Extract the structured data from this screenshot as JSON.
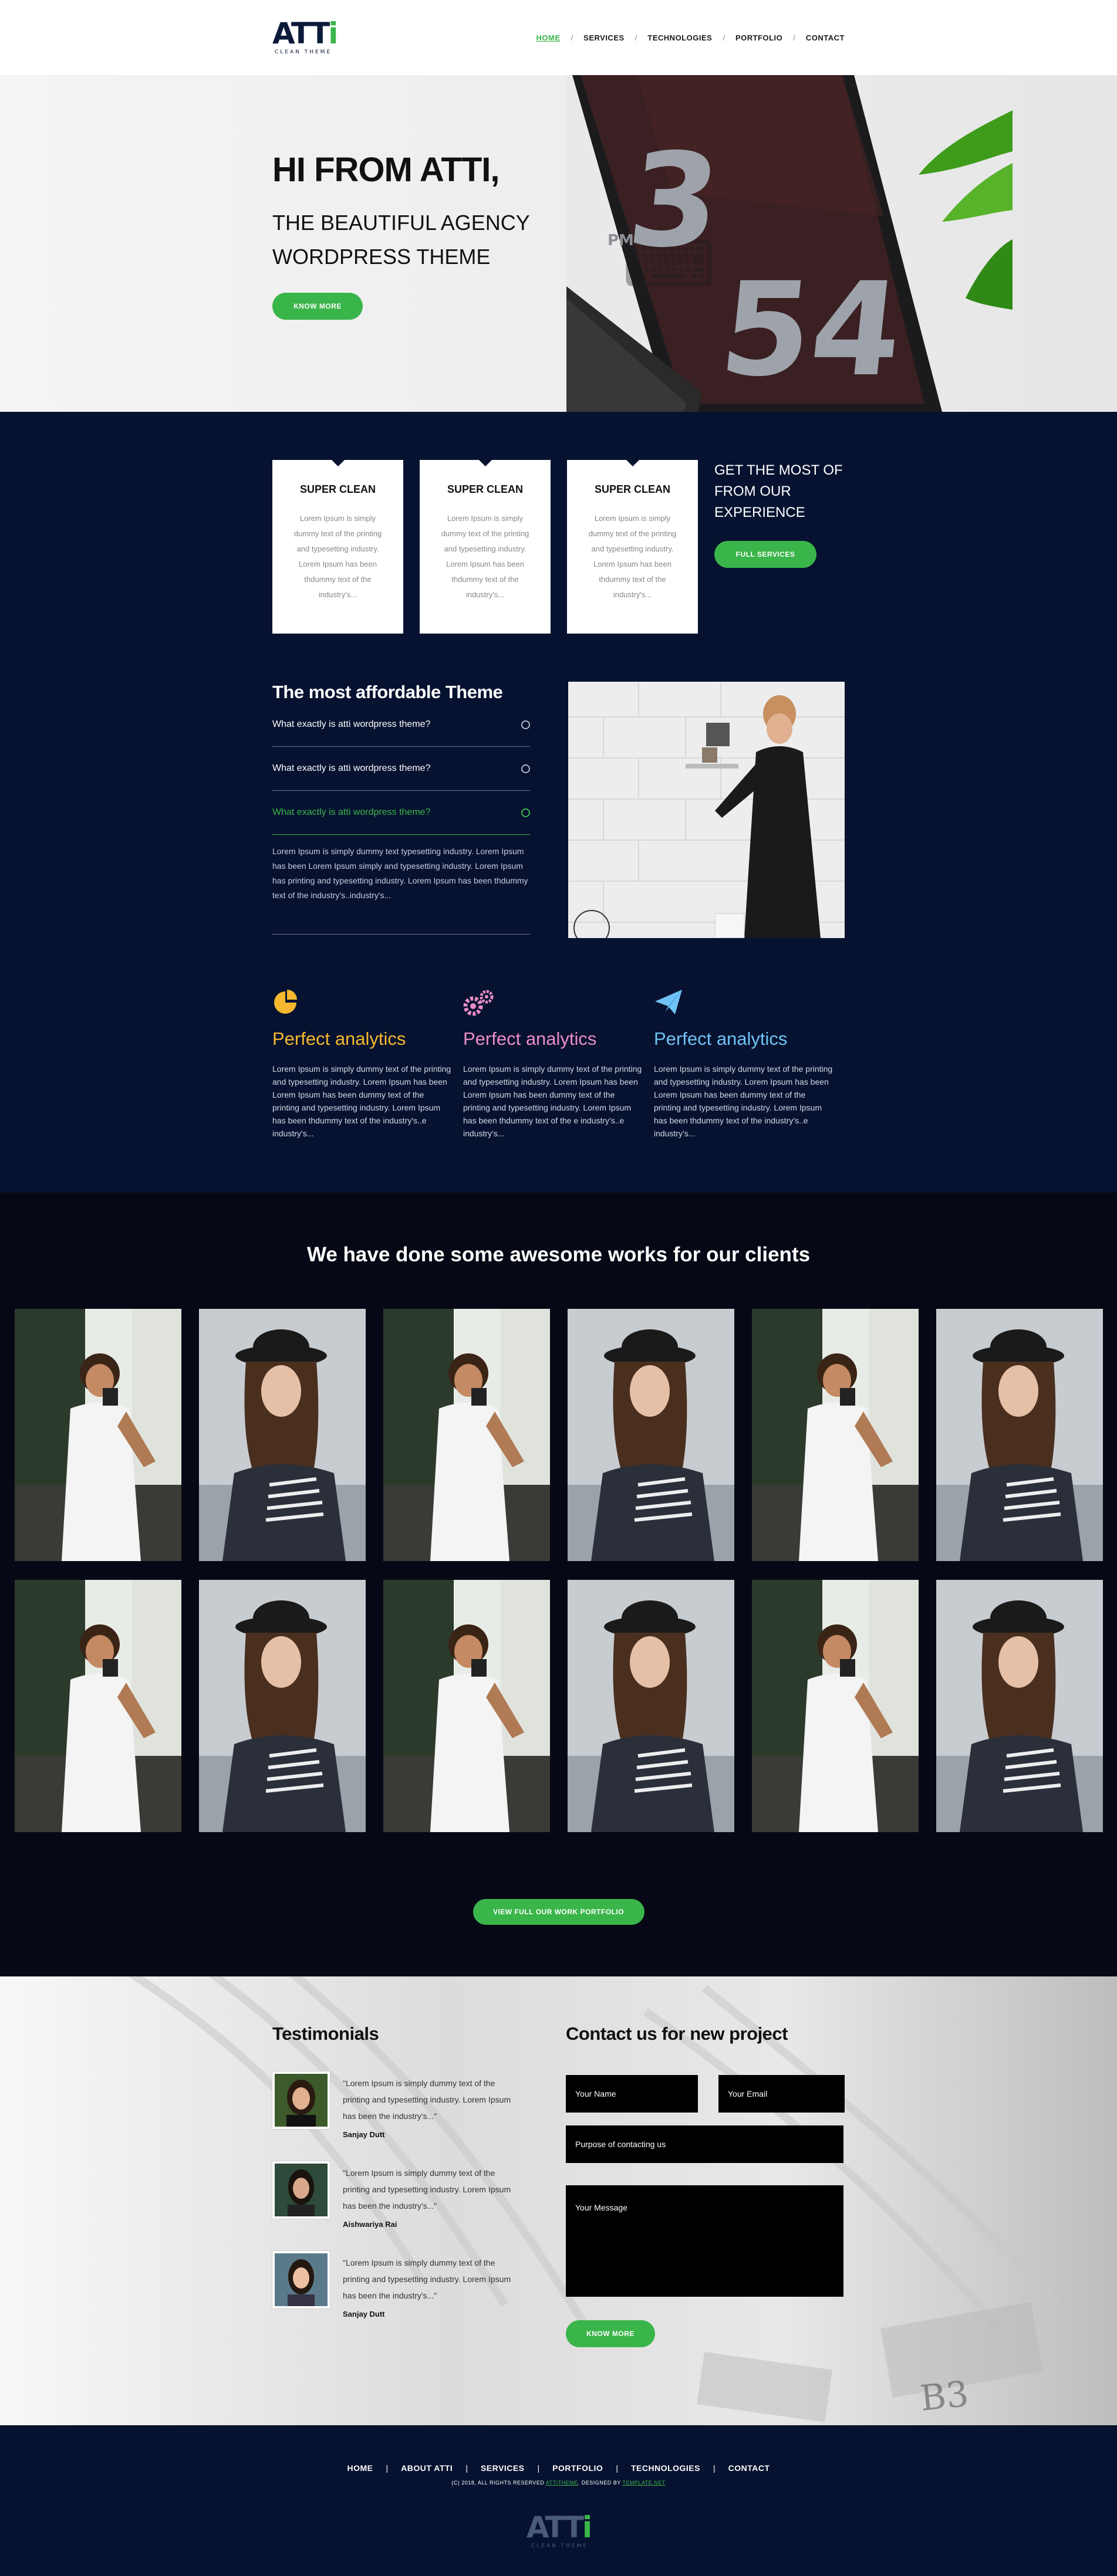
{
  "brand": {
    "logo_text": "ATTi",
    "logo_main": "ATT",
    "logo_accent": "i",
    "tagline": "CLEAN THEME"
  },
  "nav": [
    {
      "label": "HOME",
      "active": true
    },
    {
      "label": "SERVICES"
    },
    {
      "label": "TECHNOLOGIES"
    },
    {
      "label": "PORTFOLIO"
    },
    {
      "label": "CONTACT"
    }
  ],
  "nav_separator": "/",
  "hero": {
    "title": "HI FROM ATTI,",
    "subtitle": "THE BEAUTIFUL AGENCY WORDPRESS THEME",
    "button": "KNOW MORE",
    "screen_digits": {
      "left": "3",
      "right": "54",
      "small": "PM"
    }
  },
  "services": {
    "cards": [
      {
        "title": "SUPER CLEAN",
        "text": "Lorem Ipsum is simply dummy text of the printing and typesetting industry. Lorem Ipsum has been thdummy text of the industry's..."
      },
      {
        "title": "SUPER CLEAN",
        "text": "Lorem Ipsum is simply dummy text of the printing and typesetting industry. Lorem Ipsum has been thdummy text of the industry's..."
      },
      {
        "title": "SUPER CLEAN",
        "text": "Lorem Ipsum is simply dummy text of the printing and typesetting industry. Lorem Ipsum has been thdummy text of the industry's..."
      }
    ],
    "cta_title": "GET THE MOST OF FROM OUR EXPERIENCE",
    "cta_button": "FULL SERVICES"
  },
  "faq": {
    "title": "The most affordable Theme",
    "items": [
      {
        "q": "What exactly is atti wordpress theme?",
        "open": false
      },
      {
        "q": "What exactly is atti wordpress theme?",
        "open": false
      },
      {
        "q": "What exactly is atti wordpress theme?",
        "open": true
      }
    ],
    "answer": "Lorem Ipsum is simply dummy text typesetting industry. Lorem Ipsum has been Lorem Ipsum simply and typesetting industry. Lorem Ipsum has printing and typesetting industry. Lorem Ipsum has been thdummy text of the industry's..industry's..."
  },
  "features": [
    {
      "icon": "pie-chart-icon",
      "title": "Perfect analytics",
      "color": "#f5b82e",
      "text": "Lorem Ipsum is simply dummy text of the printing and typesetting industry. Lorem Ipsum has been Lorem Ipsum has been dummy text of the printing and typesetting industry. Lorem Ipsum has been thdummy text of the industry's..e industry's..."
    },
    {
      "icon": "gears-icon",
      "title": "Perfect analytics",
      "color": "#e98ec4",
      "text": "Lorem Ipsum is simply dummy text of the printing and typesetting industry. Lorem Ipsum has been Lorem Ipsum has been dummy text of the printing and typesetting industry. Lorem Ipsum has been thdummy text of the e industry's..e industry's..."
    },
    {
      "icon": "paper-plane-icon",
      "title": "Perfect analytics",
      "color": "#6ec3f4",
      "text": "Lorem Ipsum is simply dummy text of the printing and typesetting industry. Lorem Ipsum has been Lorem Ipsum has been dummy text of the printing and typesetting industry. Lorem Ipsum has been thdummy text of the industry's..e industry's..."
    }
  ],
  "portfolio": {
    "title": "We have done some awesome works for our clients",
    "button": "VIEW FULL OUR WORK PORTFOLIO",
    "tiles": [
      "man",
      "woman",
      "man",
      "woman",
      "man",
      "woman",
      "man",
      "woman",
      "man",
      "woman",
      "man",
      "woman"
    ]
  },
  "testimonials": {
    "title": "Testimonials",
    "items": [
      {
        "text": "\"Lorem Ipsum is simply dummy text of the printing and typesetting industry. Lorem Ipsum has been the industry's...\"",
        "name": "Sanjay Dutt"
      },
      {
        "text": "\"Lorem Ipsum is simply dummy text of the printing and typesetting industry. Lorem Ipsum has been the industry's...\"",
        "name": "Aishwariya Rai"
      },
      {
        "text": "\"Lorem Ipsum is simply dummy text of the printing and typesetting industry. Lorem Ipsum has been the industry's...\"",
        "name": "Sanjay Dutt"
      }
    ]
  },
  "contact": {
    "title": "Contact us for new project",
    "name_placeholder": "Your Name",
    "email_placeholder": "Your Email",
    "purpose_placeholder": "Purpose of contacting us",
    "message_placeholder": "Your Message",
    "button": "KNOW MORE"
  },
  "footer": {
    "nav": [
      "HOME",
      "ABOUT ATTI",
      "SERVICES",
      "PORTFOLIO",
      "TECHNOLOGIES",
      "CONTACT"
    ],
    "nav_separator": "|",
    "copyright_prefix": "(C) 2018, ALL RIGHTS RESERVED",
    "copyright_link1": "ATTITHEME",
    "copyright_mid": ". DESIGNED BY",
    "copyright_link2": "TEMPLATE.NET"
  },
  "colors": {
    "accent": "#3ab54a",
    "navy": "#071230",
    "portfolio_bg": "#060915"
  }
}
